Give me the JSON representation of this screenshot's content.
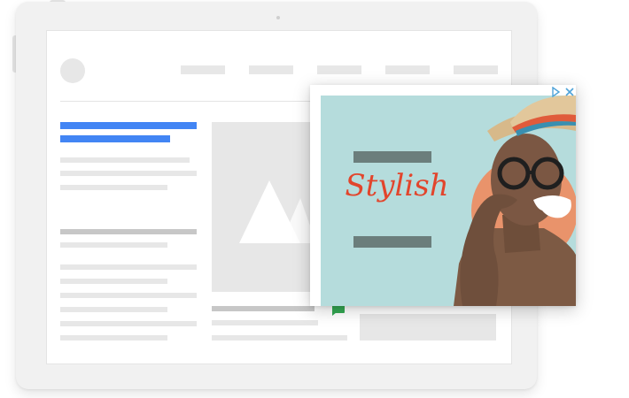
{
  "ad": {
    "headline": "Stylish",
    "adchoices_icon": "adchoices-triangle-icon",
    "close_icon": "close-x-icon"
  },
  "colors": {
    "accent_blue": "#4285f4",
    "ad_background": "#b5dcdc",
    "headline": "#e2452c",
    "placeholder_gray": "#e7e7e7"
  }
}
